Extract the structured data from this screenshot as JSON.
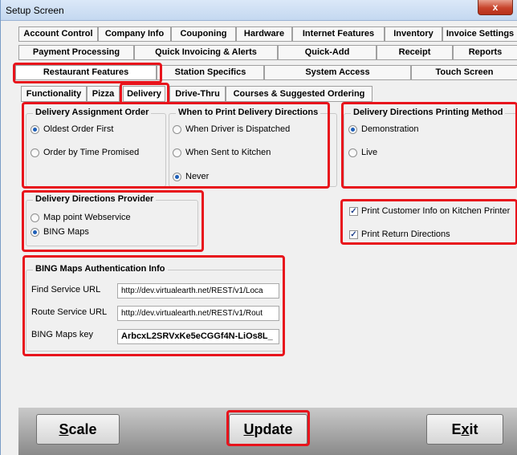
{
  "window": {
    "title": "Setup Screen",
    "close_glyph": "x"
  },
  "tabs_row1": [
    "Account Control",
    "Company Info",
    "Couponing",
    "Hardware",
    "Internet Features",
    "Inventory",
    "Invoice Settings"
  ],
  "tabs_row2": [
    "Payment Processing",
    "Quick Invoicing & Alerts",
    "Quick-Add",
    "Receipt",
    "Reports"
  ],
  "tabs_row3": [
    "Restaurant Features",
    "Station Specifics",
    "System Access",
    "Touch Screen"
  ],
  "subtabs": [
    "Functionality",
    "Pizza",
    "Delivery",
    "Drive-Thru",
    "Courses & Suggested Ordering"
  ],
  "delivery_assignment": {
    "legend": "Delivery Assignment Order",
    "options": [
      "Oldest Order First",
      "Order by Time Promised"
    ],
    "selected": 0
  },
  "print_directions": {
    "legend": "When to Print Delivery Directions",
    "options": [
      "When Driver is Dispatched",
      "When Sent to Kitchen",
      "Never"
    ],
    "selected": 2
  },
  "printing_method": {
    "legend": "Delivery Directions Printing Method",
    "options": [
      "Demonstration",
      "Live"
    ],
    "selected": 0
  },
  "provider": {
    "legend": "Delivery Directions Provider",
    "options": [
      "Map point Webservice",
      "BING Maps"
    ],
    "selected": 1
  },
  "checkboxes": [
    {
      "label": "Print Customer Info on Kitchen Printer",
      "checked": true
    },
    {
      "label": "Print Return Directions",
      "checked": true
    }
  ],
  "bing_auth": {
    "legend": "BING Maps Authentication Info",
    "find_label": "Find Service URL",
    "find_value": "http://dev.virtualearth.net/REST/v1/Loca",
    "route_label": "Route Service URL",
    "route_value": "http://dev.virtualearth.net/REST/v1/Rout",
    "key_label": "BING Maps key",
    "key_value": "ArbcxL2SRVxKe5eCGGf4N-LiOs8L_"
  },
  "buttons": {
    "scale_pre": "",
    "scale_u": "S",
    "scale_post": "cale",
    "update_pre": "",
    "update_u": "U",
    "update_post": "pdate",
    "exit_pre": "E",
    "exit_u": "x",
    "exit_post": "it"
  },
  "colors": {
    "highlight": "#e8141c",
    "radio_selected": "#1e5fb8",
    "title_bar": "#c4d8f0"
  }
}
